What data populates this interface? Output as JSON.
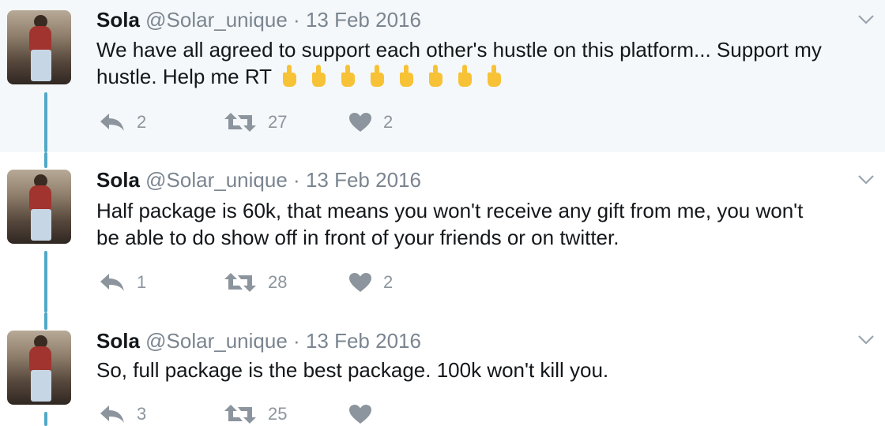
{
  "tweets": [
    {
      "name": "Sola",
      "handle": "@Solar_unique",
      "separator": "·",
      "date": "13 Feb 2016",
      "line1": "We have all agreed to support each other's hustle on this platform... Support my",
      "line2": "hustle. Help me RT",
      "emoji_count": 8,
      "emoji_icon": "pointing-up-hand-emoji",
      "replies": "2",
      "retweets": "27",
      "likes": "2"
    },
    {
      "name": "Sola",
      "handle": "@Solar_unique",
      "separator": "·",
      "date": "13 Feb 2016",
      "line1": "Half package is 60k, that means you won't receive any gift from me, you won't",
      "line2": "be able to do show off in front of your friends or on twitter.",
      "replies": "1",
      "retweets": "28",
      "likes": "2"
    },
    {
      "name": "Sola",
      "handle": "@Solar_unique",
      "separator": "·",
      "date": "13 Feb 2016",
      "line1": "So, full package is the best package. 100k won't kill you.",
      "replies": "3",
      "retweets": "25",
      "likes": ""
    }
  ],
  "colors": {
    "highlight_bg": "#f5f8fa",
    "thread_line": "#52a8c7",
    "action_gray": "#8c959d",
    "emoji_yellow": "#f7c236"
  }
}
